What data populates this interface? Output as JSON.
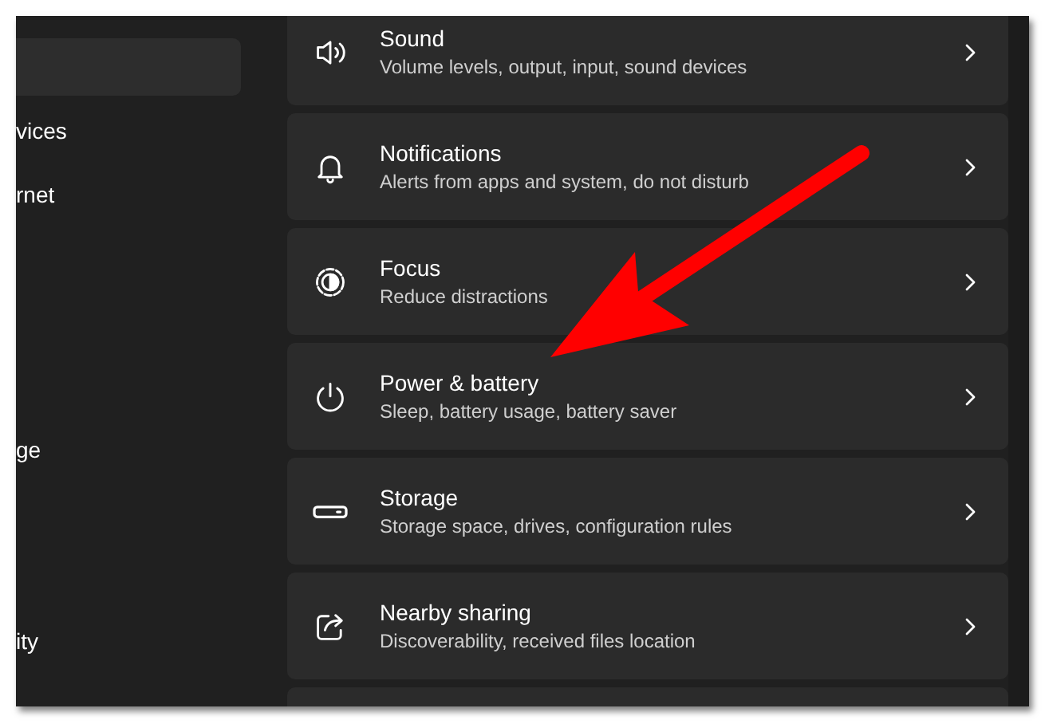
{
  "sidebar": {
    "items": [
      {
        "selected": true
      },
      {
        "label": "vices",
        "selected": false
      },
      {
        "label": "rnet",
        "selected": false
      },
      {
        "label": "ge",
        "selected": false
      },
      {
        "label": "ity",
        "selected": false
      }
    ]
  },
  "settings": [
    {
      "kind": "sound",
      "title": "Sound",
      "subtitle": "Volume levels, output, input, sound devices"
    },
    {
      "kind": "notifications",
      "title": "Notifications",
      "subtitle": "Alerts from apps and system, do not disturb"
    },
    {
      "kind": "focus",
      "title": "Focus",
      "subtitle": "Reduce distractions"
    },
    {
      "kind": "power",
      "title": "Power & battery",
      "subtitle": "Sleep, battery usage, battery saver"
    },
    {
      "kind": "storage",
      "title": "Storage",
      "subtitle": "Storage space, drives, configuration rules"
    },
    {
      "kind": "sharing",
      "title": "Nearby sharing",
      "subtitle": "Discoverability, received files location"
    },
    {
      "kind": "blank"
    }
  ],
  "annotations": [
    {
      "kind": "arrow"
    }
  ]
}
